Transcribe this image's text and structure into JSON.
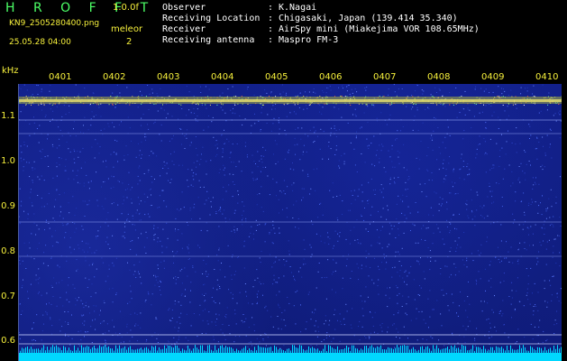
{
  "header": {
    "title": "H R O F F T",
    "version": "1.0.0f",
    "filename": "KN9_2505280400.png",
    "meleor_label": "meleor",
    "meleor_value": "2",
    "datetime": "25.05.28 04:00"
  },
  "station_info": [
    {
      "key": "Observer",
      "value": "K.Nagai"
    },
    {
      "key": "Receiving Location",
      "value": "Chigasaki, Japan (139.414 35.340)"
    },
    {
      "key": "Receiver",
      "value": "AirSpy mini (Miakejima VOR 108.65MHz)"
    },
    {
      "key": "Receiving antenna",
      "value": "Maspro FM-3"
    }
  ],
  "axis": {
    "unit": "kHz",
    "y_ticks": [
      "1.1",
      "1.0",
      "0.9",
      "0.8",
      "0.7",
      "0.6"
    ],
    "x_ticks": [
      "0401",
      "0402",
      "0403",
      "0404",
      "0405",
      "0406",
      "0407",
      "0408",
      "0409",
      "0410"
    ]
  },
  "colors": {
    "label_yellow": "#f7f13c",
    "title_green": "#4cff66",
    "background_blue": "#12208a",
    "carrier_band": "#e0d060",
    "floor_cyan": "#00e0ff"
  }
}
